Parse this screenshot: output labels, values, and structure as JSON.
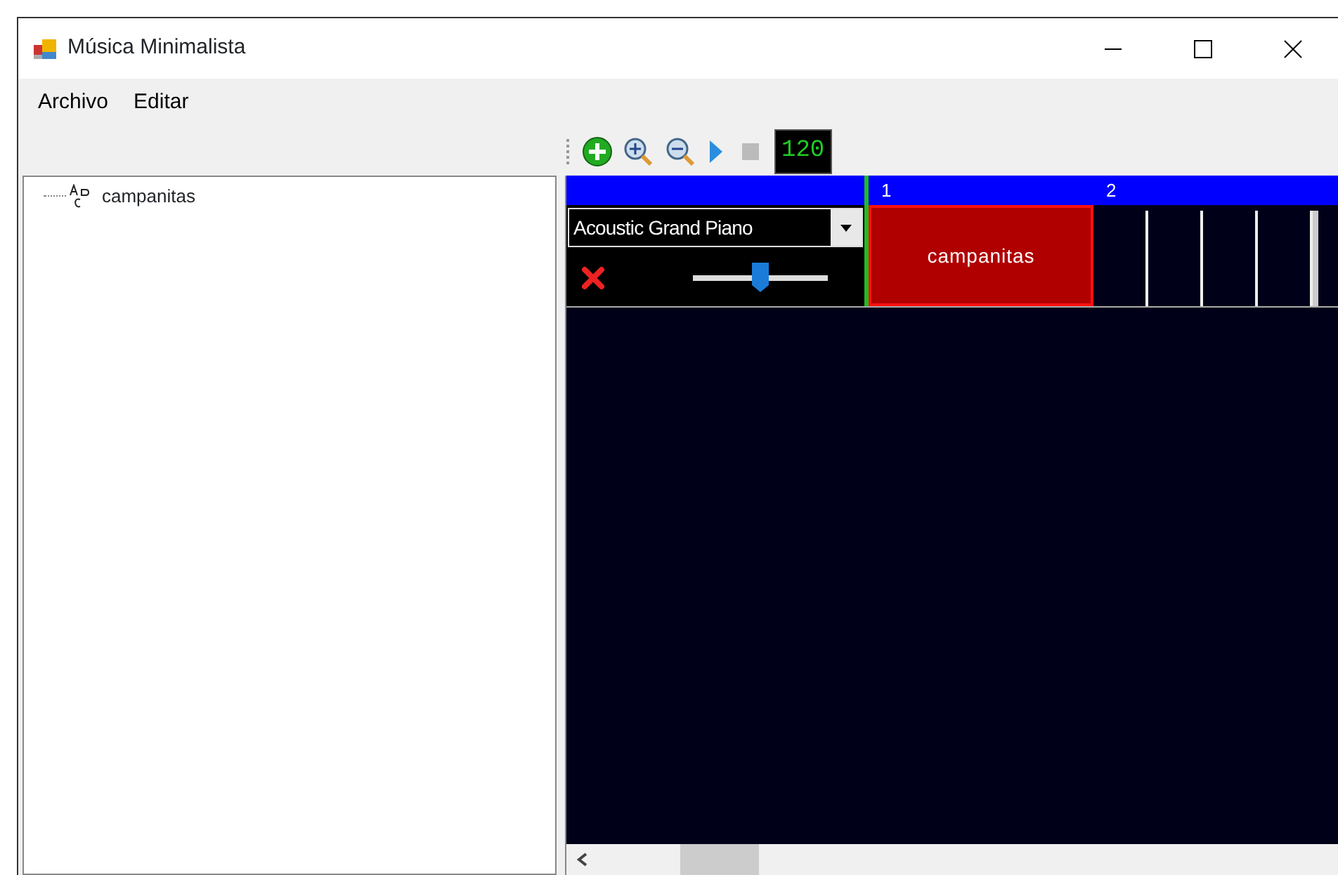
{
  "window": {
    "title": "Música Minimalista"
  },
  "menu": [
    "Archivo",
    "Editar"
  ],
  "toolbar": {
    "tempo": "120"
  },
  "tree": [
    {
      "label": "campanitas"
    }
  ],
  "ruler": [
    "1",
    "2"
  ],
  "tracks": [
    {
      "instrument": "Acoustic Grand Piano",
      "volume": {
        "level": 0.5
      },
      "clips": [
        {
          "label": "campanitas",
          "selected": true
        }
      ]
    }
  ]
}
